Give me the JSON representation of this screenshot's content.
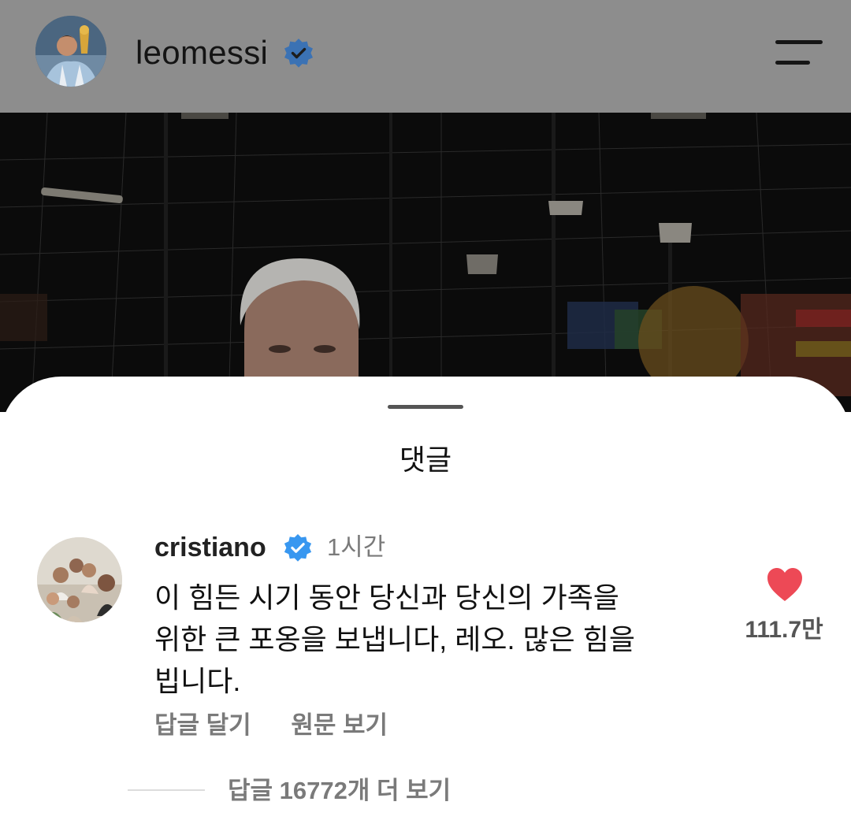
{
  "header": {
    "username": "leomessi",
    "icons": {
      "avatar": "profile-avatar",
      "verified": "verified-badge-icon",
      "menu": "hamburger-menu-icon"
    }
  },
  "post": {
    "image": "photo of a gray-haired man in a dark indoor stadium with flags"
  },
  "comments_sheet": {
    "title": "댓글",
    "comment": {
      "username": "cristiano",
      "time": "1시간",
      "text": "이 힘든 시기 동안 당신과 당신의 가족을\n위한 큰 포옹을 보냅니다, 레오. 많은 힘을\n빕니다.",
      "reply_label": "답글 달기",
      "view_original_label": "원문 보기",
      "like_count": "111.7만",
      "liked": true
    },
    "more_replies_label": "답글 16772개 더 보기"
  },
  "colors": {
    "verified": "#3897f0",
    "heart": "#ed4956",
    "dim_overlay": "#8d8d8d"
  }
}
